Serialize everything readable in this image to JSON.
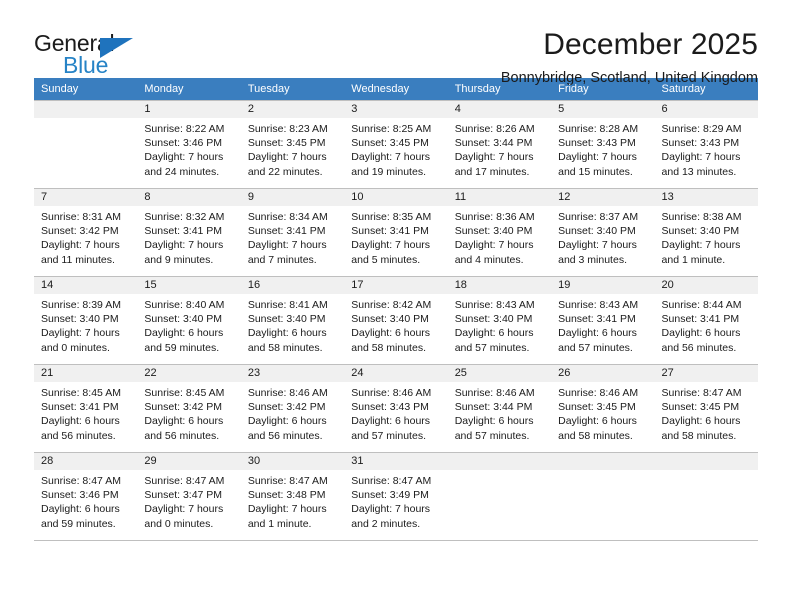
{
  "brand": {
    "name_top": "General",
    "name_bottom": "Blue",
    "triangle_icon": "blue-triangle-icon",
    "colors": {
      "dark": "#1b1b1b",
      "blue": "#2683c6",
      "triangle": "#1f73bd"
    }
  },
  "header": {
    "title": "December 2025",
    "subtitle": "Bonnybridge, Scotland, United Kingdom"
  },
  "calendar": {
    "header_background": "#3a7ebf",
    "header_text_color": "#ffffff",
    "weekday_headers": [
      "Sunday",
      "Monday",
      "Tuesday",
      "Wednesday",
      "Thursday",
      "Friday",
      "Saturday"
    ],
    "weeks": [
      [
        {
          "day": "",
          "sunrise": "",
          "sunset": "",
          "daylight": ""
        },
        {
          "day": "1",
          "sunrise": "Sunrise: 8:22 AM",
          "sunset": "Sunset: 3:46 PM",
          "daylight": "Daylight: 7 hours and 24 minutes."
        },
        {
          "day": "2",
          "sunrise": "Sunrise: 8:23 AM",
          "sunset": "Sunset: 3:45 PM",
          "daylight": "Daylight: 7 hours and 22 minutes."
        },
        {
          "day": "3",
          "sunrise": "Sunrise: 8:25 AM",
          "sunset": "Sunset: 3:45 PM",
          "daylight": "Daylight: 7 hours and 19 minutes."
        },
        {
          "day": "4",
          "sunrise": "Sunrise: 8:26 AM",
          "sunset": "Sunset: 3:44 PM",
          "daylight": "Daylight: 7 hours and 17 minutes."
        },
        {
          "day": "5",
          "sunrise": "Sunrise: 8:28 AM",
          "sunset": "Sunset: 3:43 PM",
          "daylight": "Daylight: 7 hours and 15 minutes."
        },
        {
          "day": "6",
          "sunrise": "Sunrise: 8:29 AM",
          "sunset": "Sunset: 3:43 PM",
          "daylight": "Daylight: 7 hours and 13 minutes."
        }
      ],
      [
        {
          "day": "7",
          "sunrise": "Sunrise: 8:31 AM",
          "sunset": "Sunset: 3:42 PM",
          "daylight": "Daylight: 7 hours and 11 minutes."
        },
        {
          "day": "8",
          "sunrise": "Sunrise: 8:32 AM",
          "sunset": "Sunset: 3:41 PM",
          "daylight": "Daylight: 7 hours and 9 minutes."
        },
        {
          "day": "9",
          "sunrise": "Sunrise: 8:34 AM",
          "sunset": "Sunset: 3:41 PM",
          "daylight": "Daylight: 7 hours and 7 minutes."
        },
        {
          "day": "10",
          "sunrise": "Sunrise: 8:35 AM",
          "sunset": "Sunset: 3:41 PM",
          "daylight": "Daylight: 7 hours and 5 minutes."
        },
        {
          "day": "11",
          "sunrise": "Sunrise: 8:36 AM",
          "sunset": "Sunset: 3:40 PM",
          "daylight": "Daylight: 7 hours and 4 minutes."
        },
        {
          "day": "12",
          "sunrise": "Sunrise: 8:37 AM",
          "sunset": "Sunset: 3:40 PM",
          "daylight": "Daylight: 7 hours and 3 minutes."
        },
        {
          "day": "13",
          "sunrise": "Sunrise: 8:38 AM",
          "sunset": "Sunset: 3:40 PM",
          "daylight": "Daylight: 7 hours and 1 minute."
        }
      ],
      [
        {
          "day": "14",
          "sunrise": "Sunrise: 8:39 AM",
          "sunset": "Sunset: 3:40 PM",
          "daylight": "Daylight: 7 hours and 0 minutes."
        },
        {
          "day": "15",
          "sunrise": "Sunrise: 8:40 AM",
          "sunset": "Sunset: 3:40 PM",
          "daylight": "Daylight: 6 hours and 59 minutes."
        },
        {
          "day": "16",
          "sunrise": "Sunrise: 8:41 AM",
          "sunset": "Sunset: 3:40 PM",
          "daylight": "Daylight: 6 hours and 58 minutes."
        },
        {
          "day": "17",
          "sunrise": "Sunrise: 8:42 AM",
          "sunset": "Sunset: 3:40 PM",
          "daylight": "Daylight: 6 hours and 58 minutes."
        },
        {
          "day": "18",
          "sunrise": "Sunrise: 8:43 AM",
          "sunset": "Sunset: 3:40 PM",
          "daylight": "Daylight: 6 hours and 57 minutes."
        },
        {
          "day": "19",
          "sunrise": "Sunrise: 8:43 AM",
          "sunset": "Sunset: 3:41 PM",
          "daylight": "Daylight: 6 hours and 57 minutes."
        },
        {
          "day": "20",
          "sunrise": "Sunrise: 8:44 AM",
          "sunset": "Sunset: 3:41 PM",
          "daylight": "Daylight: 6 hours and 56 minutes."
        }
      ],
      [
        {
          "day": "21",
          "sunrise": "Sunrise: 8:45 AM",
          "sunset": "Sunset: 3:41 PM",
          "daylight": "Daylight: 6 hours and 56 minutes."
        },
        {
          "day": "22",
          "sunrise": "Sunrise: 8:45 AM",
          "sunset": "Sunset: 3:42 PM",
          "daylight": "Daylight: 6 hours and 56 minutes."
        },
        {
          "day": "23",
          "sunrise": "Sunrise: 8:46 AM",
          "sunset": "Sunset: 3:42 PM",
          "daylight": "Daylight: 6 hours and 56 minutes."
        },
        {
          "day": "24",
          "sunrise": "Sunrise: 8:46 AM",
          "sunset": "Sunset: 3:43 PM",
          "daylight": "Daylight: 6 hours and 57 minutes."
        },
        {
          "day": "25",
          "sunrise": "Sunrise: 8:46 AM",
          "sunset": "Sunset: 3:44 PM",
          "daylight": "Daylight: 6 hours and 57 minutes."
        },
        {
          "day": "26",
          "sunrise": "Sunrise: 8:46 AM",
          "sunset": "Sunset: 3:45 PM",
          "daylight": "Daylight: 6 hours and 58 minutes."
        },
        {
          "day": "27",
          "sunrise": "Sunrise: 8:47 AM",
          "sunset": "Sunset: 3:45 PM",
          "daylight": "Daylight: 6 hours and 58 minutes."
        }
      ],
      [
        {
          "day": "28",
          "sunrise": "Sunrise: 8:47 AM",
          "sunset": "Sunset: 3:46 PM",
          "daylight": "Daylight: 6 hours and 59 minutes."
        },
        {
          "day": "29",
          "sunrise": "Sunrise: 8:47 AM",
          "sunset": "Sunset: 3:47 PM",
          "daylight": "Daylight: 7 hours and 0 minutes."
        },
        {
          "day": "30",
          "sunrise": "Sunrise: 8:47 AM",
          "sunset": "Sunset: 3:48 PM",
          "daylight": "Daylight: 7 hours and 1 minute."
        },
        {
          "day": "31",
          "sunrise": "Sunrise: 8:47 AM",
          "sunset": "Sunset: 3:49 PM",
          "daylight": "Daylight: 7 hours and 2 minutes."
        },
        {
          "day": "",
          "sunrise": "",
          "sunset": "",
          "daylight": ""
        },
        {
          "day": "",
          "sunrise": "",
          "sunset": "",
          "daylight": ""
        },
        {
          "day": "",
          "sunrise": "",
          "sunset": "",
          "daylight": ""
        }
      ]
    ]
  }
}
